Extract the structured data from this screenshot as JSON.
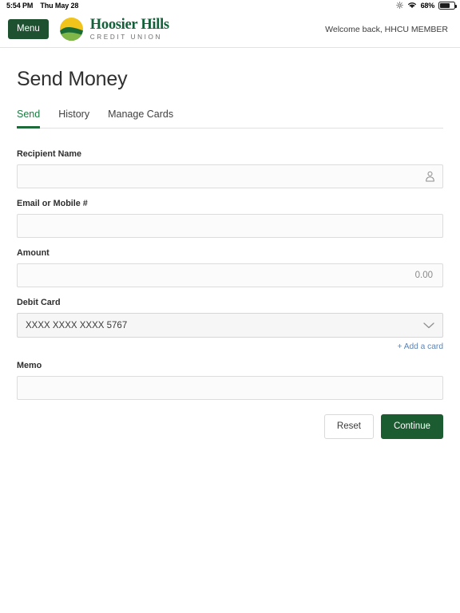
{
  "statusbar": {
    "time": "5:54 PM",
    "date": "Thu May 28",
    "battery_percent": "68%",
    "battery_level": 68,
    "icons": [
      "brightness-icon",
      "wifi-icon",
      "battery-icon"
    ]
  },
  "header": {
    "menu_label": "Menu",
    "brand_name": "Hoosier Hills",
    "brand_sub": "CREDIT UNION",
    "welcome_text": "Welcome back, HHCU MEMBER",
    "brand_green": "#13613a",
    "logo_yellow": "#f2c31a",
    "logo_dark_green": "#1b6b35",
    "logo_light_green": "#7fb848"
  },
  "page": {
    "title": "Send Money"
  },
  "tabs": [
    {
      "label": "Send",
      "active": true
    },
    {
      "label": "History",
      "active": false
    },
    {
      "label": "Manage Cards",
      "active": false
    }
  ],
  "form": {
    "recipient": {
      "label": "Recipient Name",
      "value": "",
      "placeholder": "",
      "icon": "person-icon"
    },
    "contact": {
      "label": "Email or Mobile #",
      "value": "",
      "placeholder": ""
    },
    "amount": {
      "label": "Amount",
      "value": "",
      "placeholder": "0.00"
    },
    "debit_card": {
      "label": "Debit Card",
      "selected": "XXXX XXXX XXXX 5767",
      "add_card_label": "+ Add a card",
      "chevron": "chevron-down-icon"
    },
    "memo": {
      "label": "Memo",
      "value": "",
      "placeholder": ""
    }
  },
  "actions": {
    "reset_label": "Reset",
    "continue_label": "Continue",
    "continue_color": "#1b5c30"
  }
}
